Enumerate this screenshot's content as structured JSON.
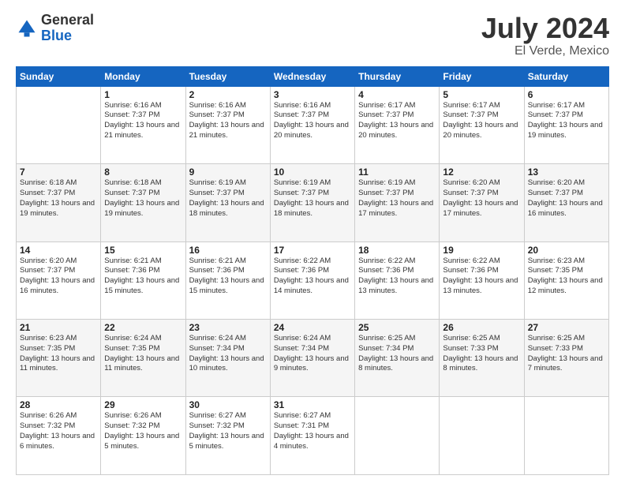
{
  "logo": {
    "general": "General",
    "blue": "Blue"
  },
  "title": {
    "month_year": "July 2024",
    "location": "El Verde, Mexico"
  },
  "weekdays": [
    "Sunday",
    "Monday",
    "Tuesday",
    "Wednesday",
    "Thursday",
    "Friday",
    "Saturday"
  ],
  "weeks": [
    [
      {
        "day": "",
        "sunrise": "",
        "sunset": "",
        "daylight": ""
      },
      {
        "day": "1",
        "sunrise": "Sunrise: 6:16 AM",
        "sunset": "Sunset: 7:37 PM",
        "daylight": "Daylight: 13 hours and 21 minutes."
      },
      {
        "day": "2",
        "sunrise": "Sunrise: 6:16 AM",
        "sunset": "Sunset: 7:37 PM",
        "daylight": "Daylight: 13 hours and 21 minutes."
      },
      {
        "day": "3",
        "sunrise": "Sunrise: 6:16 AM",
        "sunset": "Sunset: 7:37 PM",
        "daylight": "Daylight: 13 hours and 20 minutes."
      },
      {
        "day": "4",
        "sunrise": "Sunrise: 6:17 AM",
        "sunset": "Sunset: 7:37 PM",
        "daylight": "Daylight: 13 hours and 20 minutes."
      },
      {
        "day": "5",
        "sunrise": "Sunrise: 6:17 AM",
        "sunset": "Sunset: 7:37 PM",
        "daylight": "Daylight: 13 hours and 20 minutes."
      },
      {
        "day": "6",
        "sunrise": "Sunrise: 6:17 AM",
        "sunset": "Sunset: 7:37 PM",
        "daylight": "Daylight: 13 hours and 19 minutes."
      }
    ],
    [
      {
        "day": "7",
        "sunrise": "Sunrise: 6:18 AM",
        "sunset": "Sunset: 7:37 PM",
        "daylight": "Daylight: 13 hours and 19 minutes."
      },
      {
        "day": "8",
        "sunrise": "Sunrise: 6:18 AM",
        "sunset": "Sunset: 7:37 PM",
        "daylight": "Daylight: 13 hours and 19 minutes."
      },
      {
        "day": "9",
        "sunrise": "Sunrise: 6:19 AM",
        "sunset": "Sunset: 7:37 PM",
        "daylight": "Daylight: 13 hours and 18 minutes."
      },
      {
        "day": "10",
        "sunrise": "Sunrise: 6:19 AM",
        "sunset": "Sunset: 7:37 PM",
        "daylight": "Daylight: 13 hours and 18 minutes."
      },
      {
        "day": "11",
        "sunrise": "Sunrise: 6:19 AM",
        "sunset": "Sunset: 7:37 PM",
        "daylight": "Daylight: 13 hours and 17 minutes."
      },
      {
        "day": "12",
        "sunrise": "Sunrise: 6:20 AM",
        "sunset": "Sunset: 7:37 PM",
        "daylight": "Daylight: 13 hours and 17 minutes."
      },
      {
        "day": "13",
        "sunrise": "Sunrise: 6:20 AM",
        "sunset": "Sunset: 7:37 PM",
        "daylight": "Daylight: 13 hours and 16 minutes."
      }
    ],
    [
      {
        "day": "14",
        "sunrise": "Sunrise: 6:20 AM",
        "sunset": "Sunset: 7:37 PM",
        "daylight": "Daylight: 13 hours and 16 minutes."
      },
      {
        "day": "15",
        "sunrise": "Sunrise: 6:21 AM",
        "sunset": "Sunset: 7:36 PM",
        "daylight": "Daylight: 13 hours and 15 minutes."
      },
      {
        "day": "16",
        "sunrise": "Sunrise: 6:21 AM",
        "sunset": "Sunset: 7:36 PM",
        "daylight": "Daylight: 13 hours and 15 minutes."
      },
      {
        "day": "17",
        "sunrise": "Sunrise: 6:22 AM",
        "sunset": "Sunset: 7:36 PM",
        "daylight": "Daylight: 13 hours and 14 minutes."
      },
      {
        "day": "18",
        "sunrise": "Sunrise: 6:22 AM",
        "sunset": "Sunset: 7:36 PM",
        "daylight": "Daylight: 13 hours and 13 minutes."
      },
      {
        "day": "19",
        "sunrise": "Sunrise: 6:22 AM",
        "sunset": "Sunset: 7:36 PM",
        "daylight": "Daylight: 13 hours and 13 minutes."
      },
      {
        "day": "20",
        "sunrise": "Sunrise: 6:23 AM",
        "sunset": "Sunset: 7:35 PM",
        "daylight": "Daylight: 13 hours and 12 minutes."
      }
    ],
    [
      {
        "day": "21",
        "sunrise": "Sunrise: 6:23 AM",
        "sunset": "Sunset: 7:35 PM",
        "daylight": "Daylight: 13 hours and 11 minutes."
      },
      {
        "day": "22",
        "sunrise": "Sunrise: 6:24 AM",
        "sunset": "Sunset: 7:35 PM",
        "daylight": "Daylight: 13 hours and 11 minutes."
      },
      {
        "day": "23",
        "sunrise": "Sunrise: 6:24 AM",
        "sunset": "Sunset: 7:34 PM",
        "daylight": "Daylight: 13 hours and 10 minutes."
      },
      {
        "day": "24",
        "sunrise": "Sunrise: 6:24 AM",
        "sunset": "Sunset: 7:34 PM",
        "daylight": "Daylight: 13 hours and 9 minutes."
      },
      {
        "day": "25",
        "sunrise": "Sunrise: 6:25 AM",
        "sunset": "Sunset: 7:34 PM",
        "daylight": "Daylight: 13 hours and 8 minutes."
      },
      {
        "day": "26",
        "sunrise": "Sunrise: 6:25 AM",
        "sunset": "Sunset: 7:33 PM",
        "daylight": "Daylight: 13 hours and 8 minutes."
      },
      {
        "day": "27",
        "sunrise": "Sunrise: 6:25 AM",
        "sunset": "Sunset: 7:33 PM",
        "daylight": "Daylight: 13 hours and 7 minutes."
      }
    ],
    [
      {
        "day": "28",
        "sunrise": "Sunrise: 6:26 AM",
        "sunset": "Sunset: 7:32 PM",
        "daylight": "Daylight: 13 hours and 6 minutes."
      },
      {
        "day": "29",
        "sunrise": "Sunrise: 6:26 AM",
        "sunset": "Sunset: 7:32 PM",
        "daylight": "Daylight: 13 hours and 5 minutes."
      },
      {
        "day": "30",
        "sunrise": "Sunrise: 6:27 AM",
        "sunset": "Sunset: 7:32 PM",
        "daylight": "Daylight: 13 hours and 5 minutes."
      },
      {
        "day": "31",
        "sunrise": "Sunrise: 6:27 AM",
        "sunset": "Sunset: 7:31 PM",
        "daylight": "Daylight: 13 hours and 4 minutes."
      },
      {
        "day": "",
        "sunrise": "",
        "sunset": "",
        "daylight": ""
      },
      {
        "day": "",
        "sunrise": "",
        "sunset": "",
        "daylight": ""
      },
      {
        "day": "",
        "sunrise": "",
        "sunset": "",
        "daylight": ""
      }
    ]
  ]
}
